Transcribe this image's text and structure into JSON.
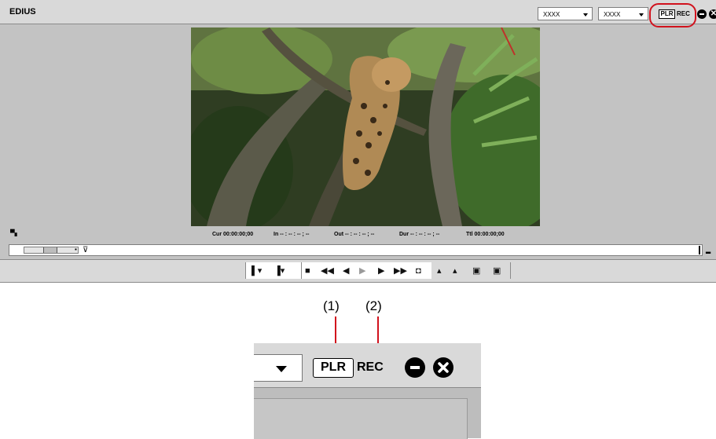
{
  "app": {
    "title": "EDIUS"
  },
  "header": {
    "dropdown1": "XXXX",
    "dropdown2": "XXXX",
    "plr_label": "PLR",
    "rec_label": "REC"
  },
  "status": {
    "cur": "Cur 00:00:00;00",
    "in": "In -- : -- : -- ; --",
    "out": "Out -- : -- : -- ; --",
    "dur": "Dur -- : -- : -- ; --",
    "ttl": "Ttl 00:00:00;00"
  },
  "callouts": {
    "label1": "(1)",
    "label2": "(2)"
  },
  "zoom": {
    "plr_label": "PLR",
    "rec_label": "REC"
  },
  "icons": [
    "chevron-down-icon",
    "minimize-icon",
    "close-icon",
    "play-icon",
    "stop-icon",
    "rewind-icon",
    "fast-forward-icon",
    "step-back-icon",
    "step-forward-icon",
    "loop-icon",
    "set-in-icon",
    "set-out-icon",
    "insert-icon",
    "overwrite-icon",
    "add-clip-icon",
    "export-icon",
    "monitor-icon",
    "timeline-marker-icon"
  ],
  "colors": {
    "highlight": "#d1121d",
    "panel": "#c3c3c3",
    "titlebar": "#d9d9d9"
  }
}
